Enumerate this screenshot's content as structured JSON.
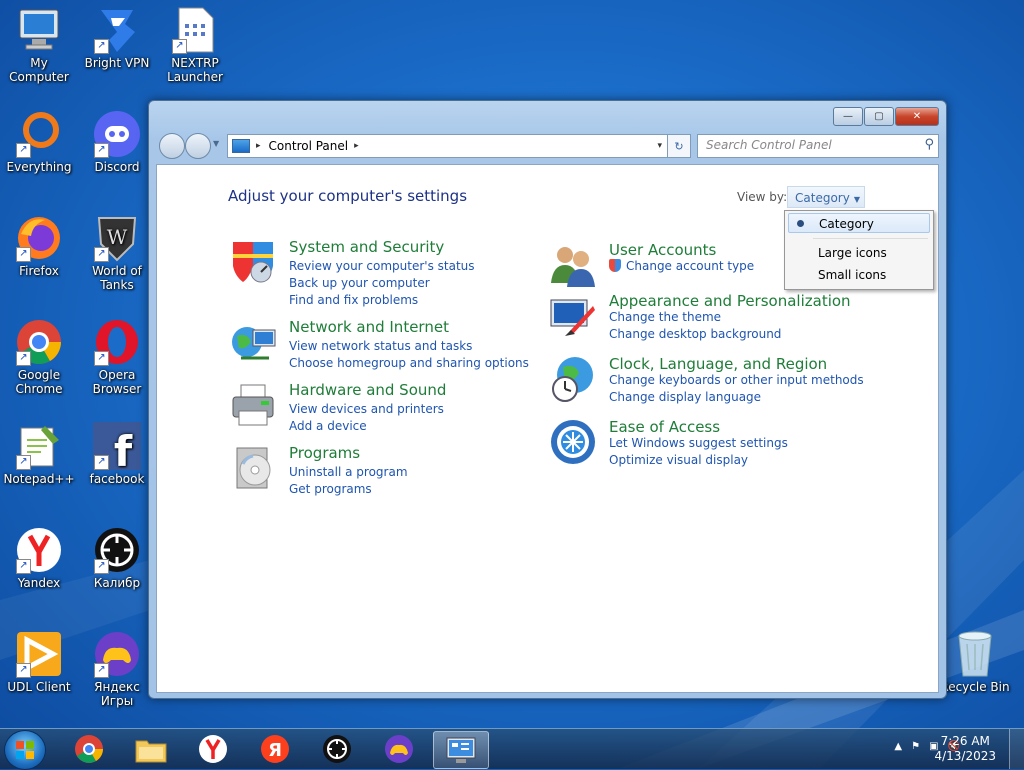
{
  "desktop": {
    "icons": [
      {
        "label": "My Computer"
      },
      {
        "label": "Bright VPN"
      },
      {
        "label": "NEXTRP Launcher"
      },
      {
        "label": "Everything"
      },
      {
        "label": "Discord"
      },
      {
        "label": "Firefox"
      },
      {
        "label": "World of Tanks"
      },
      {
        "label": "Google Chrome"
      },
      {
        "label": "Opera Browser"
      },
      {
        "label": "Notepad++"
      },
      {
        "label": "facebook"
      },
      {
        "label": "Yandex"
      },
      {
        "label": "Калибр"
      },
      {
        "label": "UDL Client"
      },
      {
        "label": "Яндекс Игры"
      },
      {
        "label": "Recycle Bin"
      }
    ]
  },
  "window": {
    "controls": {
      "minimize": "—",
      "maximize": "▢",
      "close": "✕"
    },
    "address": {
      "crumb": "Control Panel",
      "sep": "▸",
      "drop": "▾",
      "refresh_glyph": "↻"
    },
    "search": {
      "placeholder": "Search Control Panel"
    },
    "heading": "Adjust your computer's settings",
    "view_by_label": "View by:",
    "view_by_value": "Category",
    "view_menu": {
      "options": [
        "Category",
        "Large icons",
        "Small icons"
      ],
      "selected": "Category"
    },
    "categories": [
      {
        "title": "System and Security",
        "links": [
          "Review your computer's status",
          "Back up your computer",
          "Find and fix problems"
        ]
      },
      {
        "title": "Network and Internet",
        "links": [
          "View network status and tasks",
          "Choose homegroup and sharing options"
        ]
      },
      {
        "title": "Hardware and Sound",
        "links": [
          "View devices and printers",
          "Add a device"
        ]
      },
      {
        "title": "Programs",
        "links": [
          "Uninstall a program",
          "Get programs"
        ]
      },
      {
        "title": "User Accounts",
        "links": [
          "Change account type"
        ]
      },
      {
        "title": "Appearance and Personalization",
        "links": [
          "Change the theme",
          "Change desktop background"
        ]
      },
      {
        "title": "Clock, Language, and Region",
        "links": [
          "Change keyboards or other input methods",
          "Change display language"
        ]
      },
      {
        "title": "Ease of Access",
        "links": [
          "Let Windows suggest settings",
          "Optimize visual display"
        ]
      }
    ]
  },
  "taskbar": {
    "clock": {
      "time": "7:26 AM",
      "date": "4/13/2023"
    },
    "tray_chevron": "▲"
  },
  "colors": {
    "category_title": "#1e7d38",
    "link": "#1f55b0",
    "heading": "#1e3287"
  }
}
